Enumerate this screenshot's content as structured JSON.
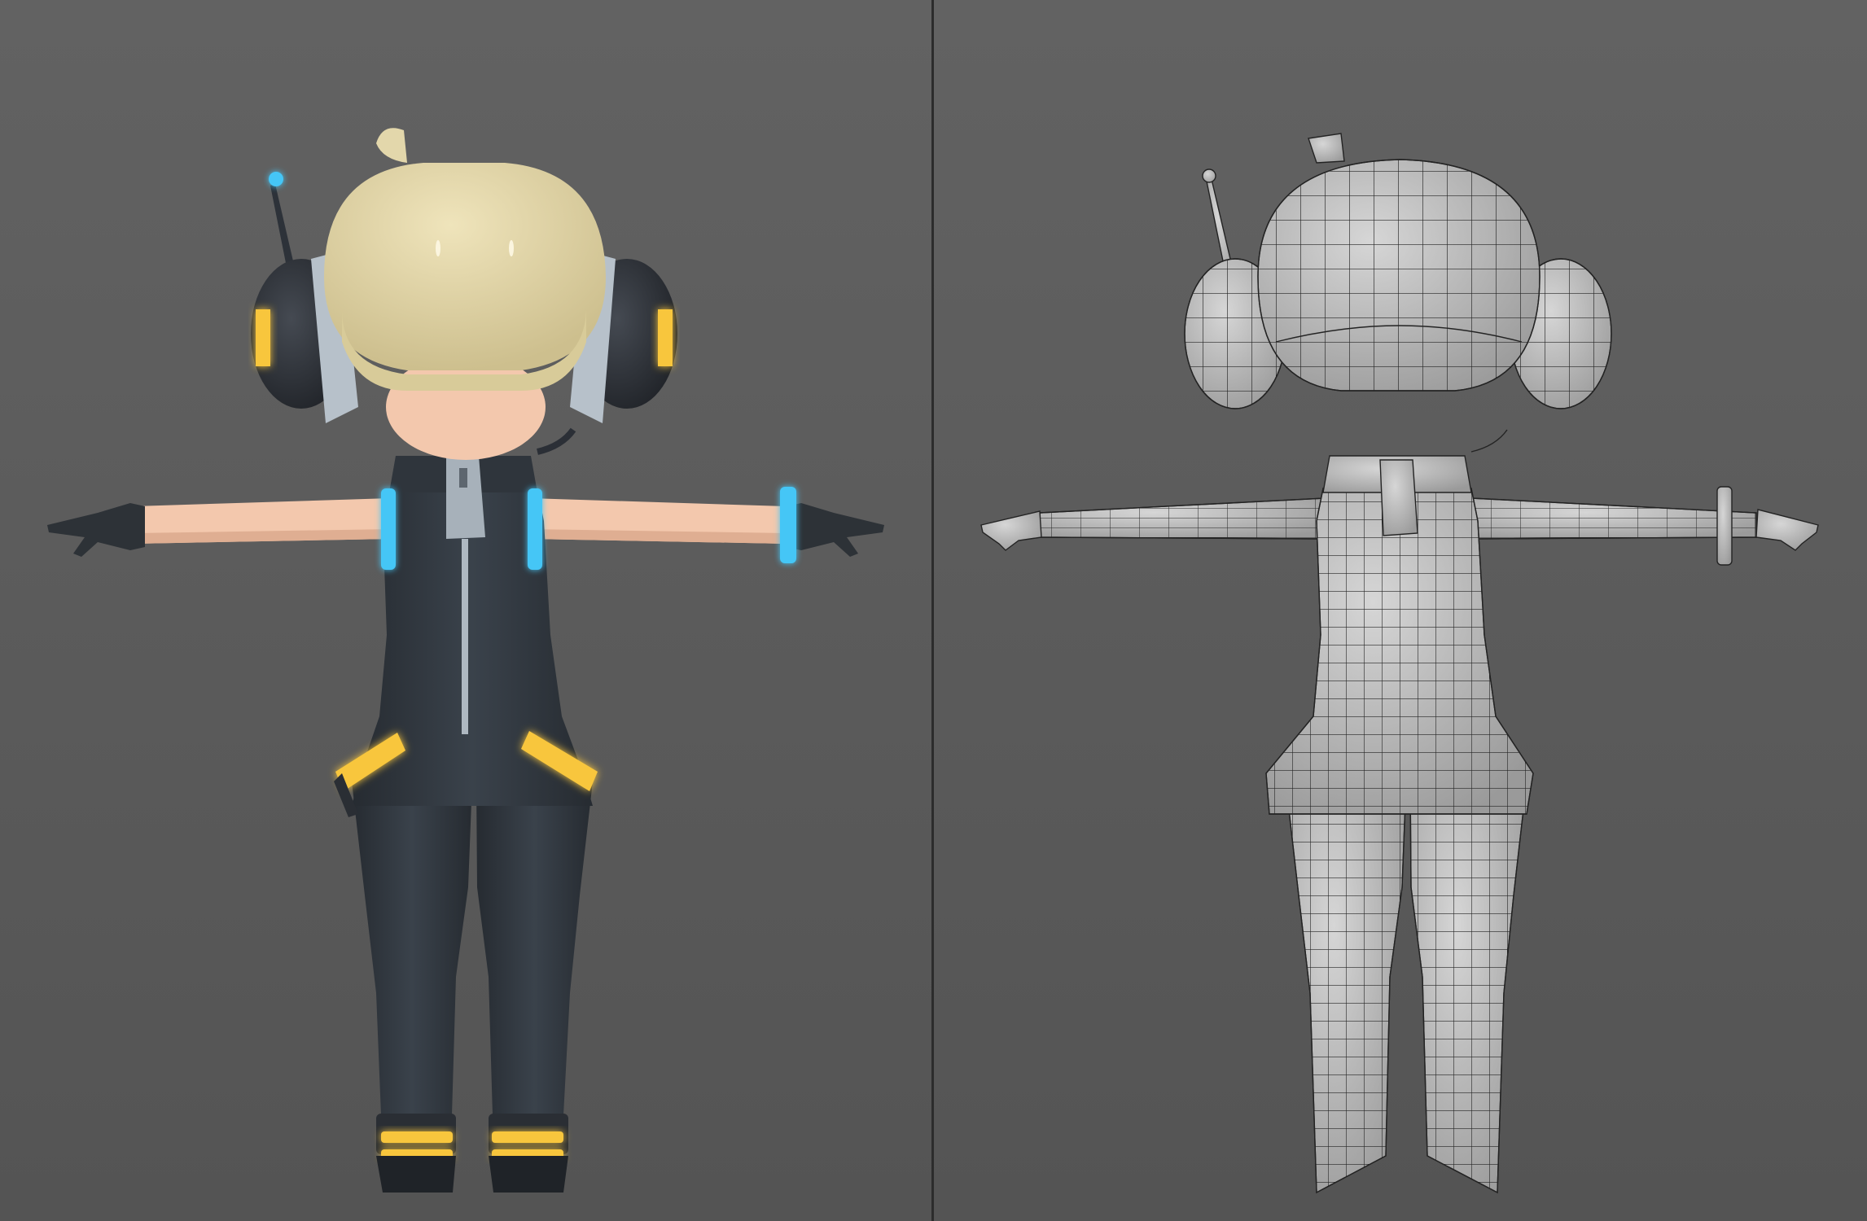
{
  "views": [
    {
      "id": "left",
      "shading": "textured",
      "colors": {
        "hair": "#e2d5a6",
        "skin": "#f3c8ad",
        "suit": "#363d45",
        "suit_shade": "#262b31",
        "accent_blue": "#45c6f6",
        "accent_yellow": "#f8c63c",
        "headphone": "#2b2f36",
        "headphone_band": "#b7c1ca",
        "glove": "#2d3237"
      }
    },
    {
      "id": "right",
      "shading": "wireframe",
      "colors": {
        "mesh_fill": "#c2c2c2",
        "mesh_line": "#232323"
      }
    }
  ],
  "colors": {
    "background_top": "#626262",
    "background_bottom": "#545454",
    "divider": "#2c2c2c"
  }
}
